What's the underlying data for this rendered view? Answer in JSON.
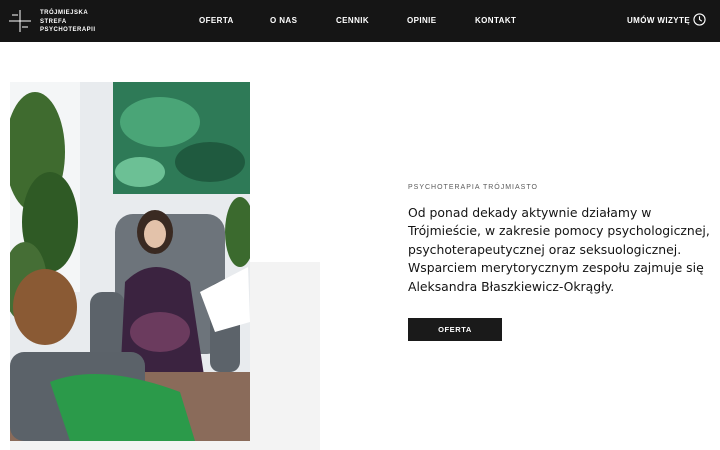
{
  "brand": {
    "lines": [
      "TRÓJMIEJSKA",
      "STREFA",
      "PSYCHOTERAPII"
    ]
  },
  "nav": {
    "items": [
      "OFERTA",
      "O NAS",
      "CENNIK",
      "OPINIE",
      "KONTAKT"
    ],
    "book_label": "UMÓW WIZYTĘ"
  },
  "hero": {
    "eyebrow": "PSYCHOTERAPIA TRÓJMIASTO",
    "headline": "Od ponad dekady aktywnie działamy w Trójmieście, w zakresie pomocy psychologicznej, psychoterapeutycznej oraz seksuologicznej. Wsparciem merytorycznym zespołu zajmuje się Aleksandra Błaszkiewicz-Okrągły.",
    "cta_label": "OFERTA"
  },
  "colors": {
    "header_bg": "#151515",
    "button_bg": "#1a1a1a",
    "grey_block": "#f3f3f3"
  },
  "icons": {
    "logo": "cross-mark-icon",
    "book": "clock-icon"
  }
}
